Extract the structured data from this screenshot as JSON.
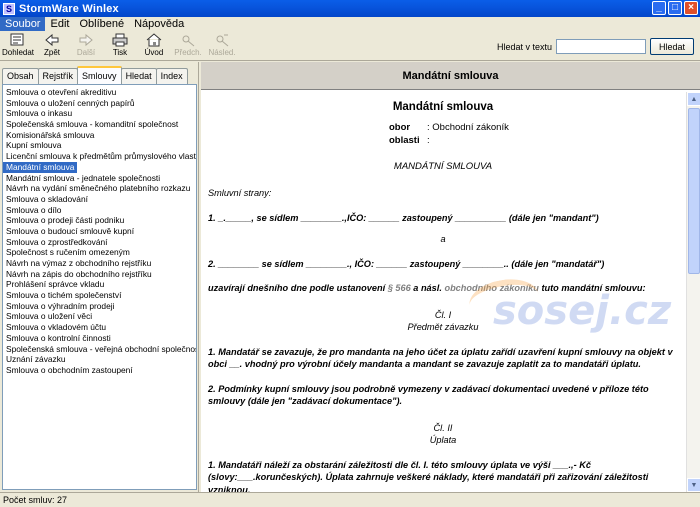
{
  "window": {
    "title": "StormWare Winlex",
    "icon": "S"
  },
  "menu": [
    "Soubor",
    "Edit",
    "Oblíbené",
    "Nápověda"
  ],
  "toolbar": {
    "buttons": [
      {
        "label": "Dohledat",
        "icon": "find-icon"
      },
      {
        "label": "Zpět",
        "icon": "back-arrow-icon"
      },
      {
        "label": "Další",
        "icon": "forward-arrow-icon"
      },
      {
        "label": "Tisk",
        "icon": "print-icon"
      },
      {
        "label": "Úvod",
        "icon": "home-icon"
      },
      {
        "label": "Předch.",
        "icon": "previous-icon"
      },
      {
        "label": "Násled.",
        "icon": "next-icon"
      }
    ],
    "search_label": "Hledat v textu",
    "search_value": "",
    "search_button": "Hledat"
  },
  "tabs": [
    "Obsah",
    "Rejstřík",
    "Smlouvy",
    "Hledat",
    "Index"
  ],
  "list": [
    "Smlouva o otevření akreditivu",
    "Smlouva o uložení cenných papírů",
    "Smlouva o inkasu",
    "Společenská smlouva - komanditní společnost",
    "Komisionářská smlouva",
    "Kupní smlouva",
    "Licenční smlouva k předmětům průmyslového vlastnictví",
    "Mandátní smlouva",
    "Mandátní smlouva - jednatele společnosti",
    "Návrh na vydání směnečného platebního rozkazu",
    "Smlouva o skladování",
    "Smlouva o dílo",
    "Smlouva o prodeji části podniku",
    "Smlouva o budoucí smlouvě kupní",
    "Smlouva o zprostředkování",
    "Společnost s ručením omezeným",
    "Návrh na výmaz z obchodního rejstříku",
    "Návrh na zápis do obchodního rejstříku",
    "Prohlášení správce vkladu",
    "Smlouva o tichém společenství",
    "Smlouva o výhradním prodeji",
    "Smlouva o uložení věci",
    "Smlouva o vkladovém účtu",
    "Smlouva o kontrolní činnosti",
    "Společenská smlouva - veřejná obchodní společnost",
    "Uznání závazku",
    "Smlouva o obchodním zastoupení"
  ],
  "selected_index": 7,
  "document": {
    "header": "Mandátní smlouva",
    "title": "Mandátní smlouva",
    "obor_label": "obor",
    "obor_value": ": Obchodní zákoník",
    "oblasti_label": "oblasti",
    "oblasti_value": ":",
    "caps_title": "MANDÁTNÍ SMLOUVA",
    "parties_label": "Smluvní strany:",
    "party1": "1. _._____, se sídlem ________.,IČO: ______ zastoupený __________ (dále jen \"mandant\")",
    "and": "a",
    "party2": "2. ________ se sídlem ________., IČO: ______ zastoupený ________.. (dále jen \"mandatář\")",
    "agree_pre": "uzavírají dnešního dne podle ustanovení",
    "agree_ref1": "§ 566",
    "agree_mid": "a násl.",
    "agree_ref2": "obchodního zákoníku",
    "agree_post": "tuto mandátní smlouvu:",
    "art1_num": "Čl. I",
    "art1_title": "Předmět závazku",
    "art1_p1": "1. Mandatář se zavazuje, že pro mandanta na jeho účet za úplatu zařídí uzavření kupní smlouvy na objekt v obci __. vhodný pro výrobní účely mandanta a mandant se zavazuje zaplatit za to mandatáři úplatu.",
    "art1_p2": "2. Podmínky kupní smlouvy jsou podrobně vymezeny v zadávací dokumentaci uvedené v příloze této smlouvy (dále jen \"zadávací dokumentace\").",
    "art2_num": "Čl. II",
    "art2_title": "Úplata",
    "art2_p1": "1. Mandatáři náleží za obstarání záležitosti dle čl. I. této smlouvy úplata ve výši ___.,- Kč (slovy:___.korunčeských). Úplata zahrnuje veškeré náklady, které mandatáři při zařizování záležitosti vzniknou.",
    "watermark": "sosej.cz"
  },
  "status": "Počet smluv: 27"
}
